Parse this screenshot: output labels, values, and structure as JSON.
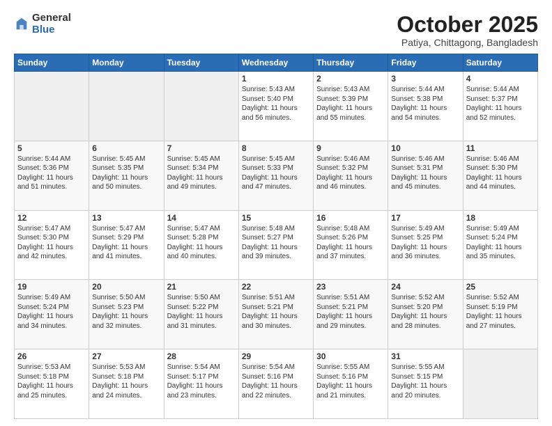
{
  "header": {
    "logo_general": "General",
    "logo_blue": "Blue",
    "month_title": "October 2025",
    "location": "Patiya, Chittagong, Bangladesh"
  },
  "weekdays": [
    "Sunday",
    "Monday",
    "Tuesday",
    "Wednesday",
    "Thursday",
    "Friday",
    "Saturday"
  ],
  "weeks": [
    [
      {
        "day": "",
        "content": ""
      },
      {
        "day": "",
        "content": ""
      },
      {
        "day": "",
        "content": ""
      },
      {
        "day": "1",
        "content": "Sunrise: 5:43 AM\nSunset: 5:40 PM\nDaylight: 11 hours\nand 56 minutes."
      },
      {
        "day": "2",
        "content": "Sunrise: 5:43 AM\nSunset: 5:39 PM\nDaylight: 11 hours\nand 55 minutes."
      },
      {
        "day": "3",
        "content": "Sunrise: 5:44 AM\nSunset: 5:38 PM\nDaylight: 11 hours\nand 54 minutes."
      },
      {
        "day": "4",
        "content": "Sunrise: 5:44 AM\nSunset: 5:37 PM\nDaylight: 11 hours\nand 52 minutes."
      }
    ],
    [
      {
        "day": "5",
        "content": "Sunrise: 5:44 AM\nSunset: 5:36 PM\nDaylight: 11 hours\nand 51 minutes."
      },
      {
        "day": "6",
        "content": "Sunrise: 5:45 AM\nSunset: 5:35 PM\nDaylight: 11 hours\nand 50 minutes."
      },
      {
        "day": "7",
        "content": "Sunrise: 5:45 AM\nSunset: 5:34 PM\nDaylight: 11 hours\nand 49 minutes."
      },
      {
        "day": "8",
        "content": "Sunrise: 5:45 AM\nSunset: 5:33 PM\nDaylight: 11 hours\nand 47 minutes."
      },
      {
        "day": "9",
        "content": "Sunrise: 5:46 AM\nSunset: 5:32 PM\nDaylight: 11 hours\nand 46 minutes."
      },
      {
        "day": "10",
        "content": "Sunrise: 5:46 AM\nSunset: 5:31 PM\nDaylight: 11 hours\nand 45 minutes."
      },
      {
        "day": "11",
        "content": "Sunrise: 5:46 AM\nSunset: 5:30 PM\nDaylight: 11 hours\nand 44 minutes."
      }
    ],
    [
      {
        "day": "12",
        "content": "Sunrise: 5:47 AM\nSunset: 5:30 PM\nDaylight: 11 hours\nand 42 minutes."
      },
      {
        "day": "13",
        "content": "Sunrise: 5:47 AM\nSunset: 5:29 PM\nDaylight: 11 hours\nand 41 minutes."
      },
      {
        "day": "14",
        "content": "Sunrise: 5:47 AM\nSunset: 5:28 PM\nDaylight: 11 hours\nand 40 minutes."
      },
      {
        "day": "15",
        "content": "Sunrise: 5:48 AM\nSunset: 5:27 PM\nDaylight: 11 hours\nand 39 minutes."
      },
      {
        "day": "16",
        "content": "Sunrise: 5:48 AM\nSunset: 5:26 PM\nDaylight: 11 hours\nand 37 minutes."
      },
      {
        "day": "17",
        "content": "Sunrise: 5:49 AM\nSunset: 5:25 PM\nDaylight: 11 hours\nand 36 minutes."
      },
      {
        "day": "18",
        "content": "Sunrise: 5:49 AM\nSunset: 5:24 PM\nDaylight: 11 hours\nand 35 minutes."
      }
    ],
    [
      {
        "day": "19",
        "content": "Sunrise: 5:49 AM\nSunset: 5:24 PM\nDaylight: 11 hours\nand 34 minutes."
      },
      {
        "day": "20",
        "content": "Sunrise: 5:50 AM\nSunset: 5:23 PM\nDaylight: 11 hours\nand 32 minutes."
      },
      {
        "day": "21",
        "content": "Sunrise: 5:50 AM\nSunset: 5:22 PM\nDaylight: 11 hours\nand 31 minutes."
      },
      {
        "day": "22",
        "content": "Sunrise: 5:51 AM\nSunset: 5:21 PM\nDaylight: 11 hours\nand 30 minutes."
      },
      {
        "day": "23",
        "content": "Sunrise: 5:51 AM\nSunset: 5:21 PM\nDaylight: 11 hours\nand 29 minutes."
      },
      {
        "day": "24",
        "content": "Sunrise: 5:52 AM\nSunset: 5:20 PM\nDaylight: 11 hours\nand 28 minutes."
      },
      {
        "day": "25",
        "content": "Sunrise: 5:52 AM\nSunset: 5:19 PM\nDaylight: 11 hours\nand 27 minutes."
      }
    ],
    [
      {
        "day": "26",
        "content": "Sunrise: 5:53 AM\nSunset: 5:18 PM\nDaylight: 11 hours\nand 25 minutes."
      },
      {
        "day": "27",
        "content": "Sunrise: 5:53 AM\nSunset: 5:18 PM\nDaylight: 11 hours\nand 24 minutes."
      },
      {
        "day": "28",
        "content": "Sunrise: 5:54 AM\nSunset: 5:17 PM\nDaylight: 11 hours\nand 23 minutes."
      },
      {
        "day": "29",
        "content": "Sunrise: 5:54 AM\nSunset: 5:16 PM\nDaylight: 11 hours\nand 22 minutes."
      },
      {
        "day": "30",
        "content": "Sunrise: 5:55 AM\nSunset: 5:16 PM\nDaylight: 11 hours\nand 21 minutes."
      },
      {
        "day": "31",
        "content": "Sunrise: 5:55 AM\nSunset: 5:15 PM\nDaylight: 11 hours\nand 20 minutes."
      },
      {
        "day": "",
        "content": ""
      }
    ]
  ]
}
